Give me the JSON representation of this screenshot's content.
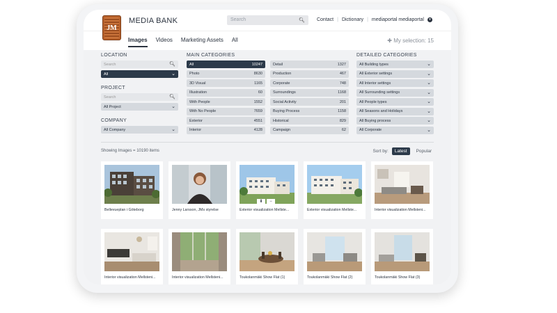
{
  "header": {
    "logo_text": "JM",
    "brand": "MEDIA BANK",
    "search_placeholder": "Search",
    "links": [
      "Contact",
      "Dictionary",
      "mediaportal mediaportal"
    ]
  },
  "nav": {
    "tabs": [
      {
        "label": "Images",
        "active": true
      },
      {
        "label": "Videos",
        "active": false
      },
      {
        "label": "Marketing Assets",
        "active": false
      },
      {
        "label": "All",
        "active": false
      }
    ],
    "selection": "My selection: 15"
  },
  "filters": {
    "location": {
      "title": "LOCATION",
      "search_placeholder": "Search",
      "selected": "All"
    },
    "project": {
      "title": "PROJECT",
      "search_placeholder": "Search",
      "selected": "All Project"
    },
    "company": {
      "title": "COMPANY",
      "selected": "All Company"
    },
    "main_categories": {
      "title": "MAIN CATEGORIES",
      "items": [
        {
          "label": "All",
          "count": "10247",
          "active": true
        },
        {
          "label": "Detail",
          "count": "1327"
        },
        {
          "label": "Photo",
          "count": "8630"
        },
        {
          "label": "Production",
          "count": "467"
        },
        {
          "label": "3D Visual",
          "count": "1165"
        },
        {
          "label": "Corporate",
          "count": "748"
        },
        {
          "label": "Illustration",
          "count": "60"
        },
        {
          "label": "Surroundings",
          "count": "1168"
        },
        {
          "label": "With People",
          "count": "1552"
        },
        {
          "label": "Social Activity",
          "count": "201"
        },
        {
          "label": "With No People",
          "count": "7659"
        },
        {
          "label": "Buying Process",
          "count": "1158"
        },
        {
          "label": "Exterior",
          "count": "4551"
        },
        {
          "label": "Historical",
          "count": "829"
        },
        {
          "label": "Interior",
          "count": "4128"
        },
        {
          "label": "Campaign",
          "count": "62"
        }
      ]
    },
    "detailed_categories": {
      "title": "DETAILED CATEGORIES",
      "items": [
        "All Building types",
        "All Exterior settings",
        "All Interior settings",
        "All Surrounding settings",
        "All People types",
        "All Seasons and Holidays",
        "All Buying process",
        "All Corporate"
      ]
    }
  },
  "results": {
    "showing": "Showing Images = 10190 items",
    "sort_label": "Sort by:",
    "sort_options": [
      {
        "label": "Latest",
        "active": true
      },
      {
        "label": "Popular",
        "active": false
      }
    ]
  },
  "gallery": [
    {
      "caption": "Bellevueplan i Göteborg",
      "kind": "building-dark"
    },
    {
      "caption": "Jenny Larsson, JMs styrelse",
      "kind": "portrait"
    },
    {
      "caption": "Exterior visualization Mellste...",
      "kind": "exterior"
    },
    {
      "caption": "Exterior visualization Mellste...",
      "kind": "exterior"
    },
    {
      "caption": "Interior visualization Mellsteni...",
      "kind": "interior"
    },
    {
      "caption": "Interior visualization Mellsteni...",
      "kind": "kitchen"
    },
    {
      "caption": "Interior visualization Mellsteni...",
      "kind": "balcony"
    },
    {
      "caption": "Toukolanmäki Show Flat (1)",
      "kind": "flat-dining"
    },
    {
      "caption": "Toukolanmäki Show Flat (2)",
      "kind": "flat-window"
    },
    {
      "caption": "Toukolanmäki Show Flat (3)",
      "kind": "flat-window"
    }
  ],
  "icons": {
    "search": "search-icon",
    "chevron": "chevron-down-icon",
    "plus": "plus-icon",
    "download": "download-icon",
    "remove": "minus-icon"
  },
  "colors": {
    "accent_dark": "#2c3a4a",
    "logo": "#b8612b"
  }
}
